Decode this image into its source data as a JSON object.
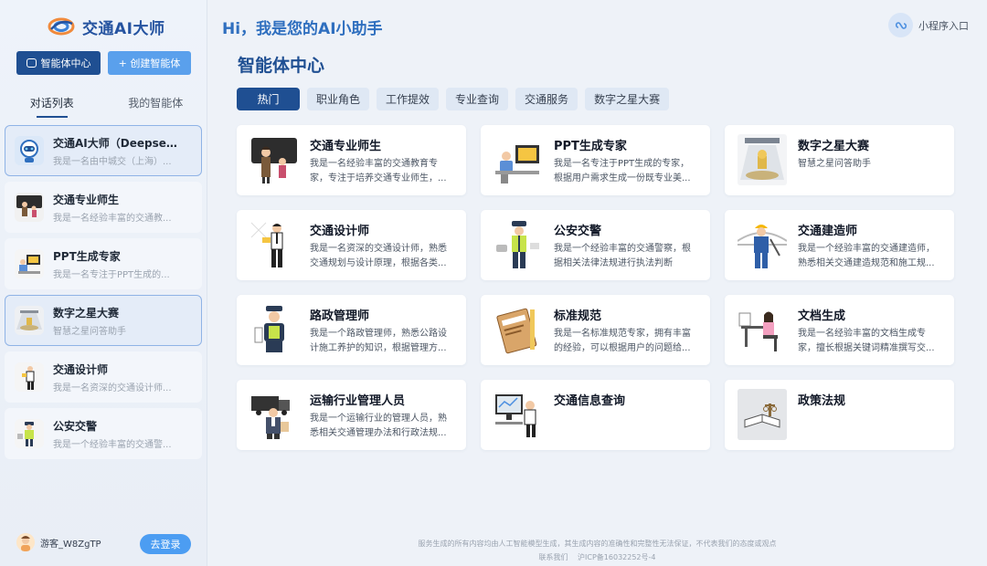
{
  "app": {
    "name": "交通AI大师"
  },
  "sidebar": {
    "agent_center_label": "智能体中心",
    "create_label": "+ 创建智能体",
    "tabs": [
      {
        "label": "对话列表",
        "active": true
      },
      {
        "label": "我的智能体",
        "active": false
      }
    ],
    "conversations": [
      {
        "title": "交通AI大师（Deepseek交",
        "desc": "我是一名由中城交（上海）...",
        "icon": "robot-icon",
        "active": true
      },
      {
        "title": "交通专业师生",
        "desc": "我是一名经验丰富的交通教...",
        "icon": "teacher-student-icon",
        "active": false
      },
      {
        "title": "PPT生成专家",
        "desc": "我是一名专注于PPT生成的...",
        "icon": "ppt-expert-icon",
        "active": false
      },
      {
        "title": "数字之星大赛",
        "desc": "智慧之星问答助手",
        "icon": "stage-icon",
        "active": true
      },
      {
        "title": "交通设计师",
        "desc": "我是一名资深的交通设计师...",
        "icon": "designer-icon",
        "active": false
      },
      {
        "title": "公安交警",
        "desc": "我是一个经验丰富的交通警...",
        "icon": "traffic-police-icon",
        "active": false
      }
    ],
    "guest_name": "游客_W8ZgTP",
    "login_label": "去登录"
  },
  "header": {
    "greeting": "Hi，我是您的AI小助手",
    "mini_program_label": "小程序入口"
  },
  "main": {
    "section_title": "智能体中心",
    "filters": [
      {
        "label": "热门",
        "active": true
      },
      {
        "label": "职业角色",
        "active": false
      },
      {
        "label": "工作提效",
        "active": false
      },
      {
        "label": "专业查询",
        "active": false
      },
      {
        "label": "交通服务",
        "active": false
      },
      {
        "label": "数字之星大赛",
        "active": false
      }
    ],
    "cards": [
      {
        "title": "交通专业师生",
        "desc": "我是一名经验丰富的交通教育专家，专注于培养交通专业师生，...",
        "icon": "teacher-student-icon"
      },
      {
        "title": "PPT生成专家",
        "desc": "我是一名专注于PPT生成的专家，根据用户需求生成一份既专业美...",
        "icon": "ppt-expert-icon"
      },
      {
        "title": "数字之星大赛",
        "desc": "智慧之星问答助手",
        "icon": "stage-icon"
      },
      {
        "title": "交通设计师",
        "desc": "我是一名资深的交通设计师，熟悉交通规划与设计原理，根据各类...",
        "icon": "designer-icon"
      },
      {
        "title": "公安交警",
        "desc": "我是一个经验丰富的交通警察，根据相关法律法规进行执法判断",
        "icon": "traffic-police-icon"
      },
      {
        "title": "交通建造师",
        "desc": "我是一个经验丰富的交通建造师，熟悉相关交通建造规范和施工规...",
        "icon": "builder-icon"
      },
      {
        "title": "路政管理师",
        "desc": "我是一个路政管理师，熟悉公路设计施工养护的知识，根据管理方...",
        "icon": "road-admin-icon"
      },
      {
        "title": "标准规范",
        "desc": "我是一名标准规范专家，拥有丰富的经验，可以根据用户的问题给...",
        "icon": "standard-book-icon"
      },
      {
        "title": "文档生成",
        "desc": "我是一名经验丰富的文档生成专家，擅长根据关键词精准撰写交...",
        "icon": "document-writer-icon"
      },
      {
        "title": "运输行业管理人员",
        "desc": "我是一个运输行业的管理人员，熟悉相关交通管理办法和行政法规...",
        "icon": "transport-manager-icon"
      },
      {
        "title": "交通信息查询",
        "desc": "",
        "icon": "info-query-icon"
      },
      {
        "title": "政策法规",
        "desc": "",
        "icon": "law-book-icon"
      }
    ]
  },
  "footer": {
    "disclaimer": "服务生成的所有内容均由人工智能模型生成，其生成内容的准确性和完整性无法保证，不代表我们的态度或观点",
    "contact": "联系我们",
    "icp": "沪ICP备16032252号-4"
  }
}
